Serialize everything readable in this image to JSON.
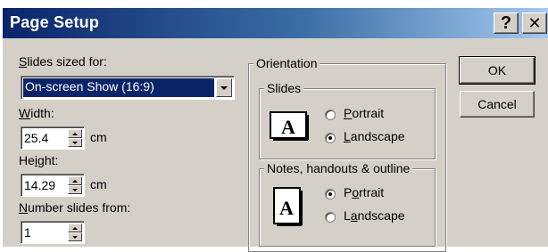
{
  "window": {
    "title": "Page Setup",
    "help_button": "?",
    "close_button": "✕"
  },
  "slides_sized_for": {
    "label_prefix": "S",
    "label_rest": "lides sized for:",
    "selected": "On-screen Show (16:9)"
  },
  "width": {
    "label_prefix": "W",
    "label_rest": "idth:",
    "value": "25.4",
    "unit": "cm"
  },
  "height": {
    "label_prefix": "He",
    "label_mid": "i",
    "label_rest": "ght:",
    "value": "14.29",
    "unit": "cm"
  },
  "number_slides_from": {
    "label_prefix": "N",
    "label_rest": "umber slides from:",
    "value": "1"
  },
  "orientation": {
    "title": "Orientation",
    "slides": {
      "title": "Slides",
      "options": [
        {
          "prefix": "P",
          "rest": "ortrait",
          "selected": false
        },
        {
          "prefix": "L",
          "rest": "andscape",
          "selected": true
        }
      ]
    },
    "notes": {
      "title": "Notes, handouts & outline",
      "options": [
        {
          "prefix": "P",
          "mid": "o",
          "rest": "rtrait",
          "selected": true
        },
        {
          "prefix": "L",
          "mid": "a",
          "rest": "ndscape",
          "selected": false
        }
      ]
    }
  },
  "buttons": {
    "ok": "OK",
    "cancel": "Cancel"
  },
  "icons": {
    "orientation_glyph": "A",
    "dropdown": "chevron-down-icon",
    "spin": "spinner-arrows-icon"
  }
}
